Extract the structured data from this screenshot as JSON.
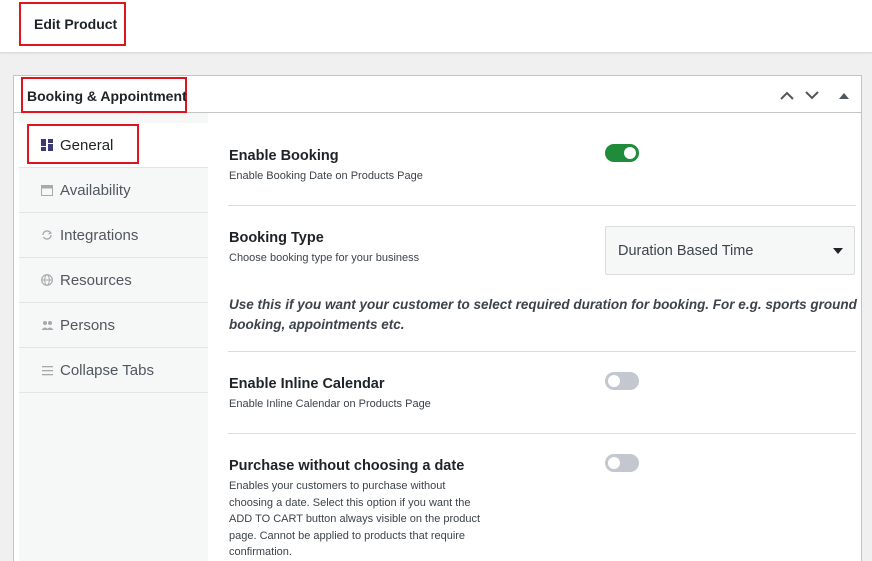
{
  "topbar": {
    "title": "Edit Product"
  },
  "metabox": {
    "title": "Booking & Appointment"
  },
  "tabs": [
    {
      "label": "General",
      "icon": "grid-icon"
    },
    {
      "label": "Availability",
      "icon": "calendar-icon"
    },
    {
      "label": "Integrations",
      "icon": "sync-icon"
    },
    {
      "label": "Resources",
      "icon": "globe-icon"
    },
    {
      "label": "Persons",
      "icon": "people-icon"
    },
    {
      "label": "Collapse Tabs",
      "icon": "menu-lines-icon"
    }
  ],
  "settings": {
    "enable_booking": {
      "title": "Enable Booking",
      "desc": "Enable Booking Date on Products Page",
      "enabled": true
    },
    "booking_type": {
      "title": "Booking Type",
      "desc": "Choose booking type for your business",
      "selected": "Duration Based Time",
      "note": "Use this if you want your customer to select required duration for booking. For e.g. sports ground booking, appointments etc."
    },
    "inline_calendar": {
      "title": "Enable Inline Calendar",
      "desc": "Enable Inline Calendar on Products Page",
      "enabled": false
    },
    "purchase_without_date": {
      "title": "Purchase without choosing a date",
      "desc": "Enables your customers to purchase without choosing a date. Select this option if you want the ADD TO CART button always visible on the product page. Cannot be applied to products that require confirmation.",
      "enabled": false
    }
  },
  "colors": {
    "accent_green": "#1e8c3a",
    "highlight_red": "#e0141e",
    "icon_purple": "#3c3a75"
  }
}
